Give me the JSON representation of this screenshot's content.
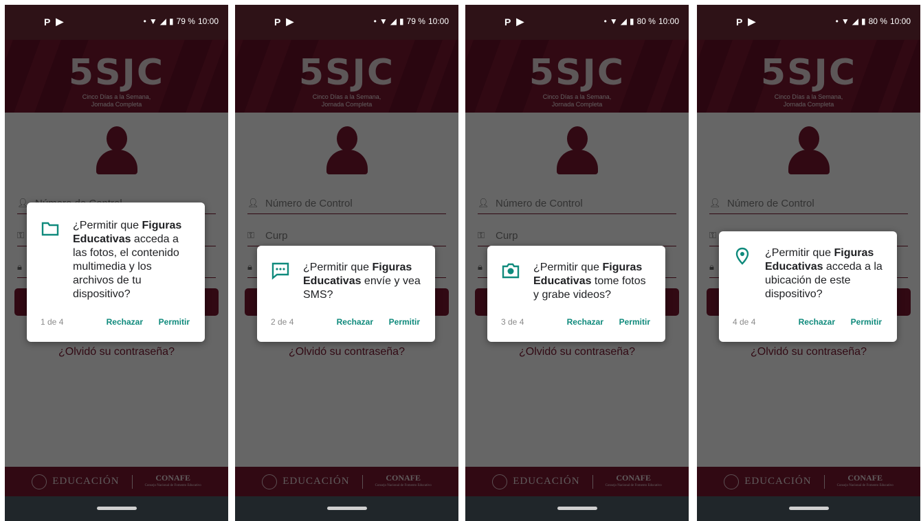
{
  "colors": {
    "brand": "#7a1731",
    "status_bar": "#2e1217",
    "nav_bar": "#20262a",
    "dialog_accent": "#0f8a7c"
  },
  "app": {
    "logo_text": "5SJC",
    "tagline_line1": "Cinco Días a la Semana,",
    "tagline_line2": "Jornada Completa",
    "control_placeholder": "Número de Control",
    "curp_placeholder": "Curp",
    "forgot_link": "¿Olvidó su contraseña?",
    "footer_education": "EDUCACIÓN",
    "footer_conafe": "CONAFE",
    "footer_conafe_sub": "Consejo Nacional de Fomento Educativo"
  },
  "status": {
    "time": "10:00",
    "icons_left": [
      "p-icon",
      "play-icon"
    ],
    "icons_right": [
      "dot-icon",
      "wifi-icon",
      "signal-icon",
      "battery-icon"
    ]
  },
  "screens": [
    {
      "battery": "79 %",
      "dialog": {
        "icon": "folder-icon",
        "prefix": "¿Permitir que ",
        "app_name": "Figuras Educativas",
        "suffix": " acceda a las fotos, el contenido multimedia y los archivos de tu dispositivo?",
        "counter": "1 de 4",
        "reject": "Rechazar",
        "allow": "Permitir"
      }
    },
    {
      "battery": "79 %",
      "dialog": {
        "icon": "sms-icon",
        "prefix": "¿Permitir que ",
        "app_name": "Figuras Educativas",
        "suffix": " envíe y vea SMS?",
        "counter": "2 de 4",
        "reject": "Rechazar",
        "allow": "Permitir"
      }
    },
    {
      "battery": "80 %",
      "dialog": {
        "icon": "camera-icon",
        "prefix": "¿Permitir que ",
        "app_name": "Figuras Educativas",
        "suffix": " tome fotos y grabe videos?",
        "counter": "3 de 4",
        "reject": "Rechazar",
        "allow": "Permitir"
      }
    },
    {
      "battery": "80 %",
      "dialog": {
        "icon": "location-pin-icon",
        "prefix": "¿Permitir que ",
        "app_name": "Figuras Educativas",
        "suffix": " acceda a la ubicación de este dispositivo?",
        "counter": "4 de 4",
        "reject": "Rechazar",
        "allow": "Permitir"
      }
    }
  ]
}
